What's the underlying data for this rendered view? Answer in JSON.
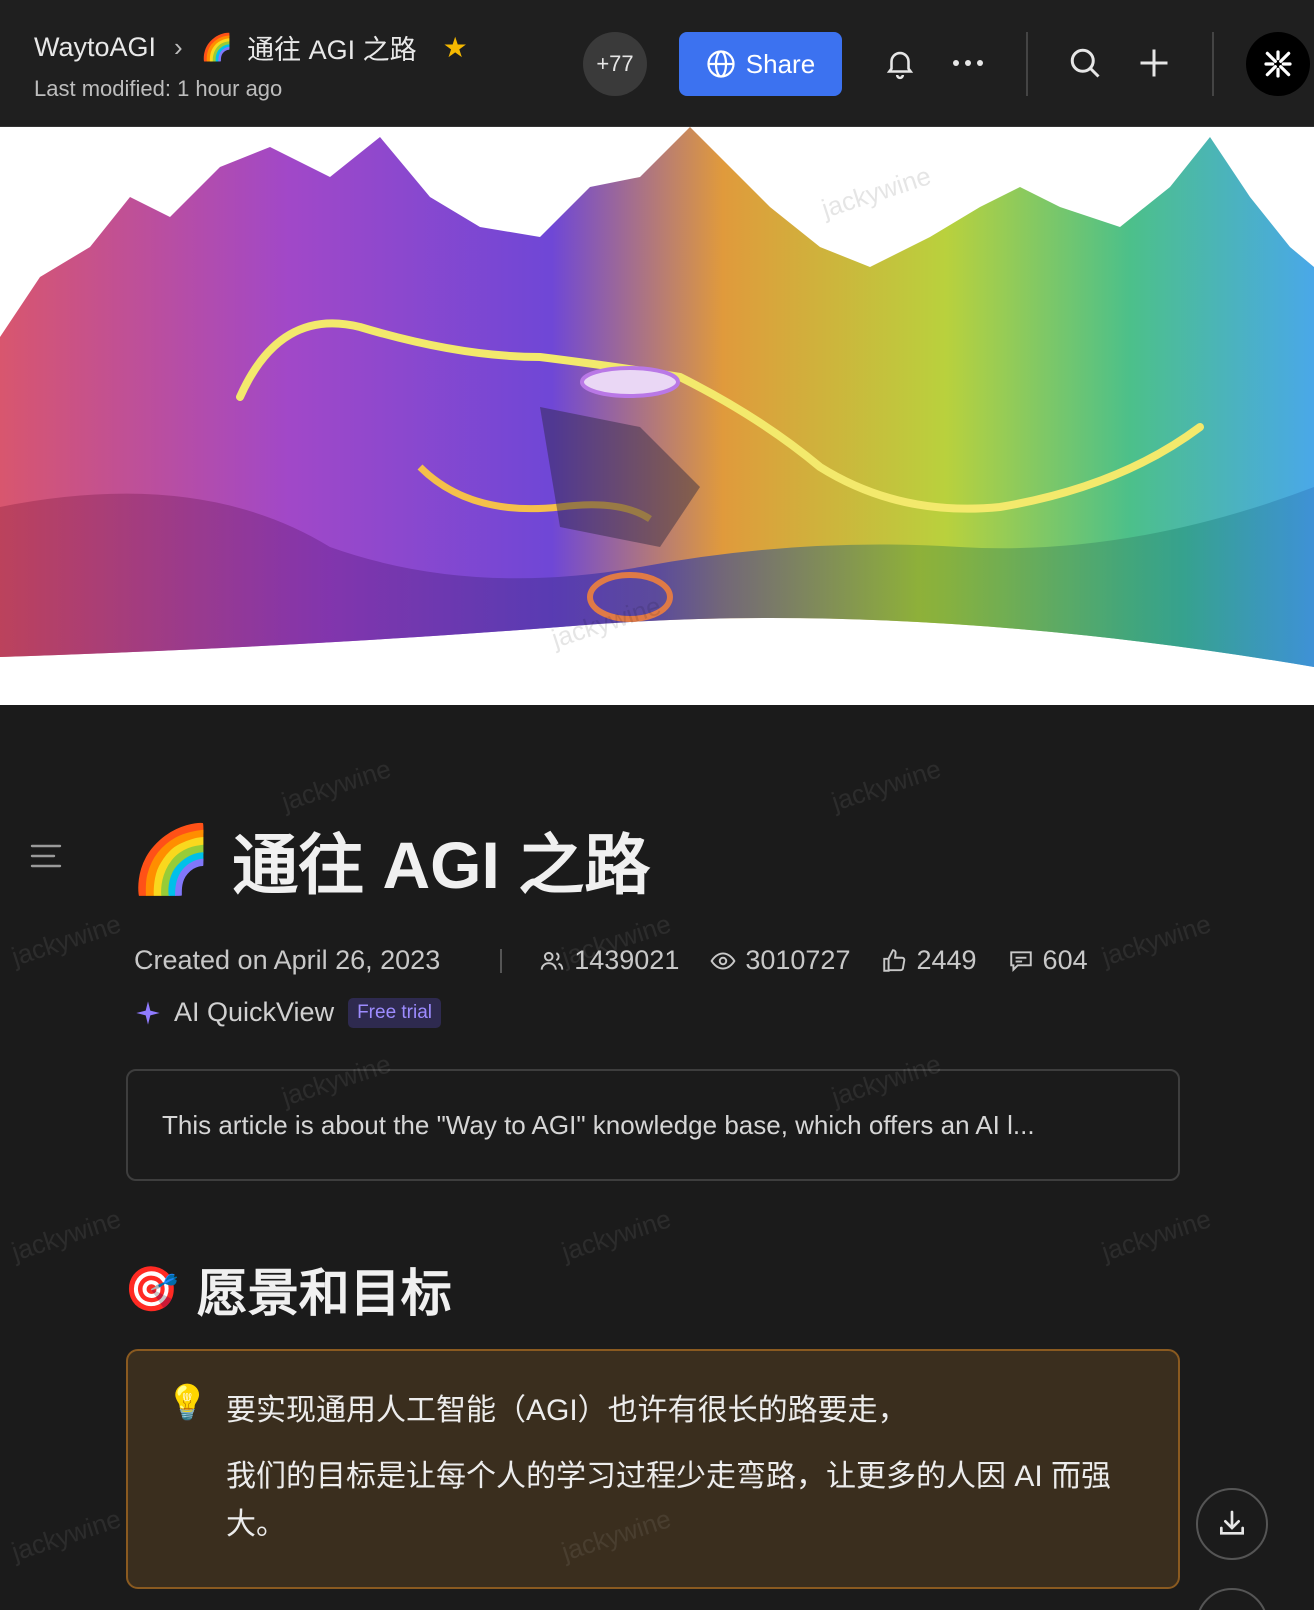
{
  "header": {
    "workspace": "WaytoAGI",
    "page_emoji": "🌈",
    "page_title": "通往 AGI 之路",
    "last_modified": "Last modified: 1 hour ago",
    "collaborator_count": "+77",
    "share_label": "Share"
  },
  "document": {
    "title_emoji": "🌈",
    "title": "通往 AGI 之路",
    "created": "Created on April 26, 2023",
    "stats": {
      "collaborators": "1439021",
      "views": "3010727",
      "likes": "2449",
      "comments": "604"
    },
    "quickview_label": "AI QuickView",
    "quickview_badge": "Free trial",
    "summary": "This article is about the \"Way to AGI\" knowledge base, which offers an AI l...",
    "section_emoji": "🎯",
    "section_title": "愿景和目标",
    "callout_emoji": "💡",
    "callout_line1": "要实现通用人工智能（AGI）也许有很长的路要走，",
    "callout_line2": "我们的目标是让每个人的学习过程少走弯路，让更多的人因 AI 而强大。"
  },
  "watermark": "jackywine",
  "colors": {
    "share_blue": "#3c72f0",
    "star": "#f5b800",
    "badge_text": "#9d8cff",
    "callout_border": "#8a5a20"
  }
}
